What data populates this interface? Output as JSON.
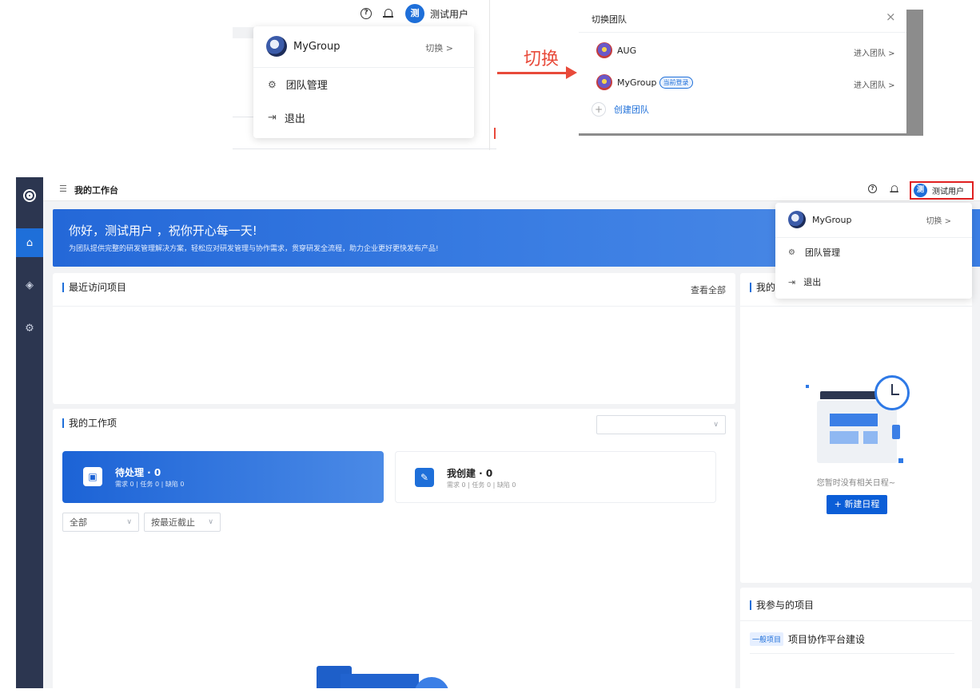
{
  "zoom_left": {
    "user_avatar_char": "测",
    "user_name": "测试用户",
    "group_name": "MyGroup",
    "switch_label": "切换 >",
    "team_manage": "团队管理",
    "logout": "退出"
  },
  "switch_annotation": {
    "label": "切换",
    "color": "#e84a3a"
  },
  "zoom_right": {
    "title": "切换团队",
    "close": "×",
    "teams": [
      {
        "name": "AUG",
        "current_tag": "",
        "enter": "进入团队 >"
      },
      {
        "name": "MyGroup",
        "current_tag": "当前登录",
        "enter": "进入团队 >"
      }
    ],
    "create_team": "创建团队",
    "create_plus": "+"
  },
  "app": {
    "header": {
      "menu_icon": "☰",
      "title": "我的工作台",
      "user_avatar_char": "测",
      "user_name": "测试用户"
    },
    "dropdown": {
      "group_name": "MyGroup",
      "switch_label": "切换 >",
      "team_manage": "团队管理",
      "logout": "退出"
    },
    "banner": {
      "greeting": "你好，测试用户 ，祝你开心每一天!",
      "subtitle": "为团队提供完整的研发管理解决方案，轻松应对研发管理与协作需求，贯穿研发全流程，助力企业更好更快发布产品!"
    },
    "recent_projects": {
      "title": "最近访问项目",
      "view_all": "查看全部"
    },
    "work_items": {
      "title": "我的工作项",
      "pending": {
        "label": "待处理 · 0",
        "sub": "需求 0 | 任务 0 | 缺陷 0"
      },
      "created": {
        "label": "我创建 · 0",
        "sub": "需求 0 | 任务 0 | 缺陷 0"
      },
      "filter_all": "全部",
      "filter_sort": "按最近截止"
    },
    "schedule": {
      "title": "我的",
      "empty_text": "您暂时没有相关日程~",
      "new_button": "+ 新建日程"
    },
    "participated": {
      "title": "我参与的项目",
      "items": [
        {
          "tag": "一般项目",
          "name": "项目协作平台建设"
        }
      ]
    },
    "colors": {
      "sidebar": "#2c3650",
      "primary": "#1e6fd9",
      "highlight_border": "#e02020"
    }
  }
}
